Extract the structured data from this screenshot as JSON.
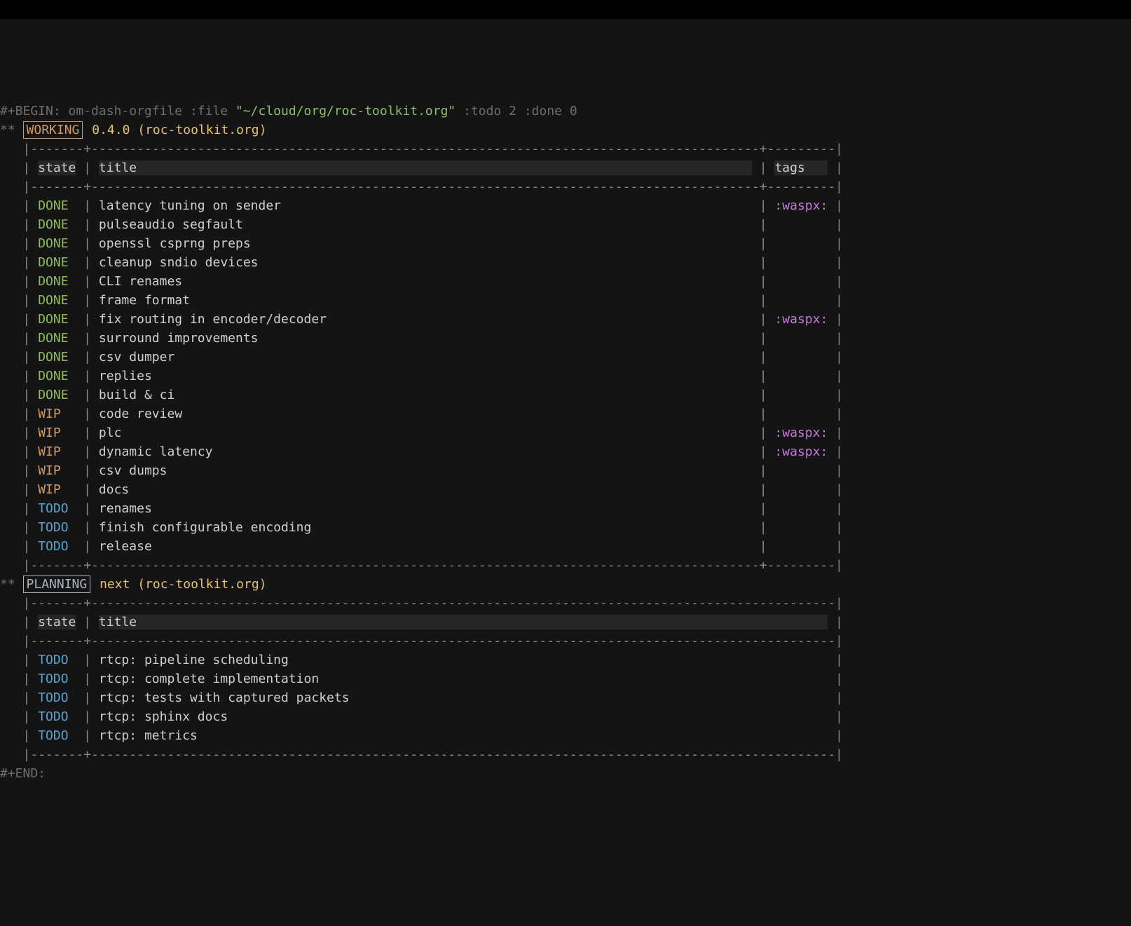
{
  "begin_line": {
    "prefix": "#+BEGIN:",
    "block_name": "om-dash-orgfile",
    "file_key": ":file",
    "file_path": "\"~/cloud/org/roc-toolkit.org\"",
    "todo_key": ":todo",
    "todo_val": "2",
    "done_key": ":done",
    "done_val": "0"
  },
  "end_line": "#+END:",
  "stars": "**",
  "sections": [
    {
      "keyword": "WORKING",
      "keyword_class": "kw-working",
      "title": "0.4.0 (roc-toolkit.org)",
      "has_tags_col": true,
      "headers": {
        "state": "state",
        "title": "title",
        "tags": "tags"
      },
      "rows": [
        {
          "state": "DONE",
          "state_class": "done",
          "title": "latency tuning on sender",
          "tag": ":waspx:"
        },
        {
          "state": "DONE",
          "state_class": "done",
          "title": "pulseaudio segfault",
          "tag": ""
        },
        {
          "state": "DONE",
          "state_class": "done",
          "title": "openssl csprng preps",
          "tag": ""
        },
        {
          "state": "DONE",
          "state_class": "done",
          "title": "cleanup sndio devices",
          "tag": ""
        },
        {
          "state": "DONE",
          "state_class": "done",
          "title": "CLI renames",
          "tag": ""
        },
        {
          "state": "DONE",
          "state_class": "done",
          "title": "frame format",
          "tag": ""
        },
        {
          "state": "DONE",
          "state_class": "done",
          "title": "fix routing in encoder/decoder",
          "tag": ":waspx:"
        },
        {
          "state": "DONE",
          "state_class": "done",
          "title": "surround improvements",
          "tag": ""
        },
        {
          "state": "DONE",
          "state_class": "done",
          "title": "csv dumper",
          "tag": ""
        },
        {
          "state": "DONE",
          "state_class": "done",
          "title": "replies",
          "tag": ""
        },
        {
          "state": "DONE",
          "state_class": "done",
          "title": "build & ci",
          "tag": ""
        },
        {
          "state": "WIP",
          "state_class": "wip",
          "title": "code review",
          "tag": ""
        },
        {
          "state": "WIP",
          "state_class": "wip",
          "title": "plc",
          "tag": ":waspx:"
        },
        {
          "state": "WIP",
          "state_class": "wip",
          "title": "dynamic latency",
          "tag": ":waspx:"
        },
        {
          "state": "WIP",
          "state_class": "wip",
          "title": "csv dumps",
          "tag": ""
        },
        {
          "state": "WIP",
          "state_class": "wip",
          "title": "docs",
          "tag": ""
        },
        {
          "state": "TODO",
          "state_class": "todo",
          "title": "renames",
          "tag": ""
        },
        {
          "state": "TODO",
          "state_class": "todo",
          "title": "finish configurable encoding",
          "tag": ""
        },
        {
          "state": "TODO",
          "state_class": "todo",
          "title": "release",
          "tag": ""
        }
      ]
    },
    {
      "keyword": "PLANNING",
      "keyword_class": "kw-planning",
      "title": "next (roc-toolkit.org)",
      "has_tags_col": false,
      "headers": {
        "state": "state",
        "title": "title"
      },
      "rows": [
        {
          "state": "TODO",
          "state_class": "todo",
          "title": "rtcp: pipeline scheduling"
        },
        {
          "state": "TODO",
          "state_class": "todo",
          "title": "rtcp: complete implementation"
        },
        {
          "state": "TODO",
          "state_class": "todo",
          "title": "rtcp: tests with captured packets"
        },
        {
          "state": "TODO",
          "state_class": "todo",
          "title": "rtcp: sphinx docs"
        },
        {
          "state": "TODO",
          "state_class": "todo",
          "title": "rtcp: metrics"
        }
      ]
    }
  ]
}
